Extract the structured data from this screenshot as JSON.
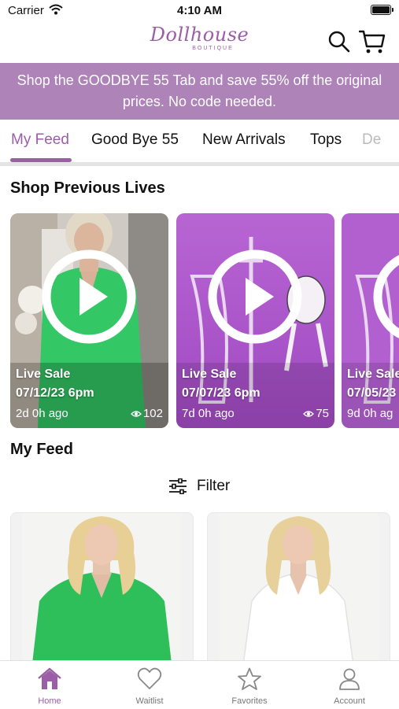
{
  "status_bar": {
    "carrier": "Carrier",
    "time": "4:10 AM"
  },
  "header": {
    "logo_script": "Dollhouse",
    "logo_sub": "BOUTIQUE",
    "search_icon": "search-icon",
    "cart_icon": "cart-icon"
  },
  "promo": {
    "text": "Shop the GOODBYE 55 Tab and save 55% off the original prices. No code needed."
  },
  "tabs": [
    {
      "label": "My Feed",
      "active": true
    },
    {
      "label": "Good Bye 55"
    },
    {
      "label": "New Arrivals"
    },
    {
      "label": "Tops"
    },
    {
      "label": "De"
    }
  ],
  "lives_section": {
    "title": "Shop Previous Lives"
  },
  "lives": [
    {
      "title": "Live Sale",
      "date": "07/12/23 6pm",
      "ago": "2d 0h ago",
      "views": "102"
    },
    {
      "title": "Live Sale",
      "date": "07/07/23 6pm",
      "ago": "7d 0h ago",
      "views": "75"
    },
    {
      "title": "Live Sale",
      "date": "07/05/23",
      "ago": "9d 0h ag",
      "views": ""
    }
  ],
  "feed_section": {
    "title": "My Feed",
    "filter_label": "Filter"
  },
  "colors": {
    "brand_purple": "#9b5ea7",
    "promo_bg": "#ad83b8",
    "card_purple": "#b266c9",
    "shirt_green": "#2fbf5a"
  },
  "bottom_nav": [
    {
      "label": "Home",
      "icon": "home-icon",
      "active": true
    },
    {
      "label": "Waitlist",
      "icon": "heart-icon"
    },
    {
      "label": "Favorites",
      "icon": "star-icon"
    },
    {
      "label": "Account",
      "icon": "person-icon"
    }
  ]
}
